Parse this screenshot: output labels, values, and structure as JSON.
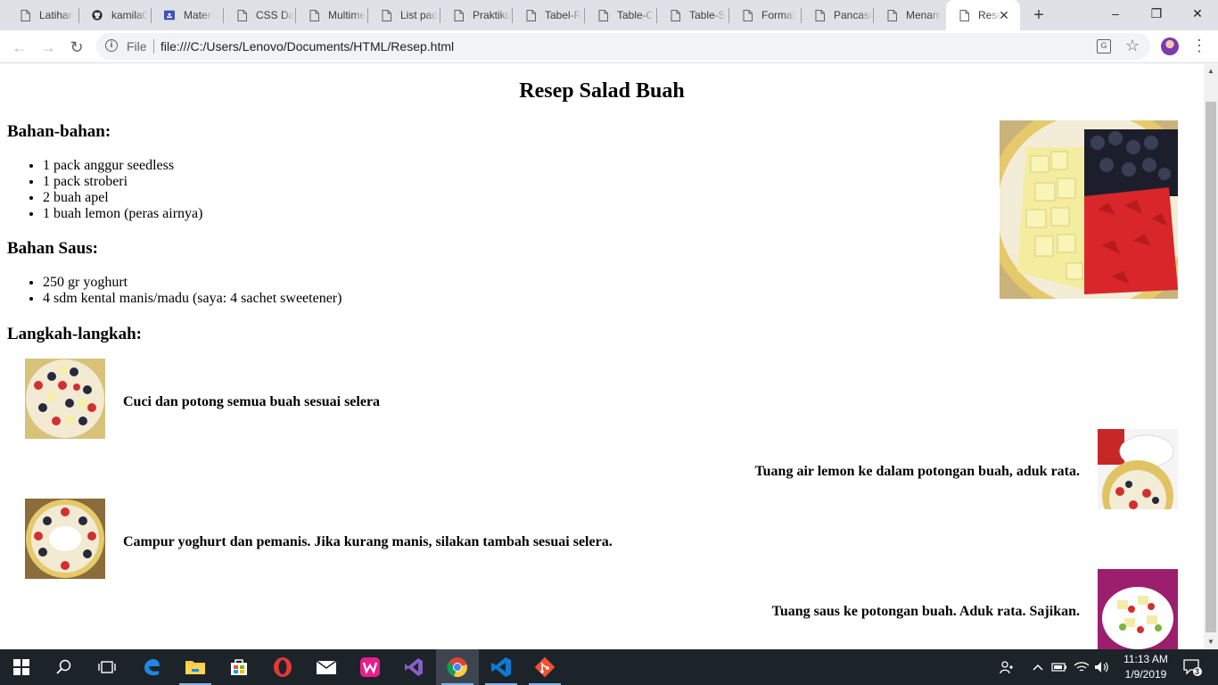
{
  "browser": {
    "tabs": [
      {
        "title": "Latihan",
        "icon": "page-icon",
        "active": false
      },
      {
        "title": "kamila0",
        "icon": "github-icon",
        "active": false
      },
      {
        "title": "Materi",
        "icon": "classroom-icon",
        "active": false
      },
      {
        "title": "CSS Da",
        "icon": "page-icon",
        "active": false
      },
      {
        "title": "Multime",
        "icon": "page-icon",
        "active": false
      },
      {
        "title": "List pad",
        "icon": "page-icon",
        "active": false
      },
      {
        "title": "Praktiku",
        "icon": "page-icon",
        "active": false
      },
      {
        "title": "Tabel-R",
        "icon": "page-icon",
        "active": false
      },
      {
        "title": "Table-C",
        "icon": "page-icon",
        "active": false
      },
      {
        "title": "Table-S",
        "icon": "page-icon",
        "active": false
      },
      {
        "title": "Format",
        "icon": "page-icon",
        "active": false
      },
      {
        "title": "Pancasi",
        "icon": "page-icon",
        "active": false
      },
      {
        "title": "Menam",
        "icon": "page-icon",
        "active": false
      },
      {
        "title": "Resep",
        "icon": "page-icon",
        "active": true
      }
    ],
    "omnibox": {
      "scheme_label": "File",
      "url": "file:///C:/Users/Lenovo/Documents/HTML/Resep.html"
    }
  },
  "page": {
    "title": "Resep Salad Buah",
    "ingredients_heading": "Bahan-bahan:",
    "ingredients": [
      "1 pack anggur seedless",
      "1 pack stroberi",
      "2 buah apel",
      "1 buah lemon (peras airnya)"
    ],
    "sauce_heading": "Bahan Saus:",
    "sauce": [
      "250 gr yoghurt",
      "4 sdm kental manis/madu (saya: 4 sachet sweetener)"
    ],
    "steps_heading": "Langkah-langkah:",
    "steps": [
      {
        "text": "Cuci dan potong semua buah sesuai selera"
      },
      {
        "text": "Tuang air lemon ke dalam potongan buah, aduk rata."
      },
      {
        "text": "Campur yoghurt dan pemanis. Jika kurang manis, silakan tambah sesuai selera."
      },
      {
        "text": "Tuang saus ke potongan buah. Aduk rata. Sajikan."
      }
    ]
  },
  "taskbar": {
    "clock_time": "11:13 AM",
    "clock_date": "1/9/2019",
    "notification_count": "3"
  }
}
